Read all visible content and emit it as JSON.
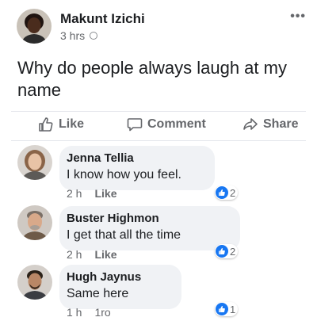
{
  "post": {
    "author": "Makunt Izichi",
    "time": "3 hrs",
    "more_icon": "more-dots-icon",
    "text": "Why do people always laugh at my name"
  },
  "actions": {
    "like_label": "Like",
    "comment_label": "Comment",
    "share_label": "Share"
  },
  "comments": [
    {
      "name": "Jenna Tellia",
      "text": "I know how you feel.",
      "time": "2 h",
      "action": "Like",
      "reactions": "2"
    },
    {
      "name": "Buster Highmon",
      "text": "I get that all the time",
      "time": "2 h",
      "action": "Like",
      "reactions": "2"
    },
    {
      "name": "Hugh Jaynus",
      "text": "Same here",
      "time": "1 h",
      "action": "1ro",
      "reactions": "1"
    }
  ],
  "colors": {
    "accent": "#1877f2",
    "bubble": "#f0f2f5",
    "secondary_text": "#65676b"
  }
}
